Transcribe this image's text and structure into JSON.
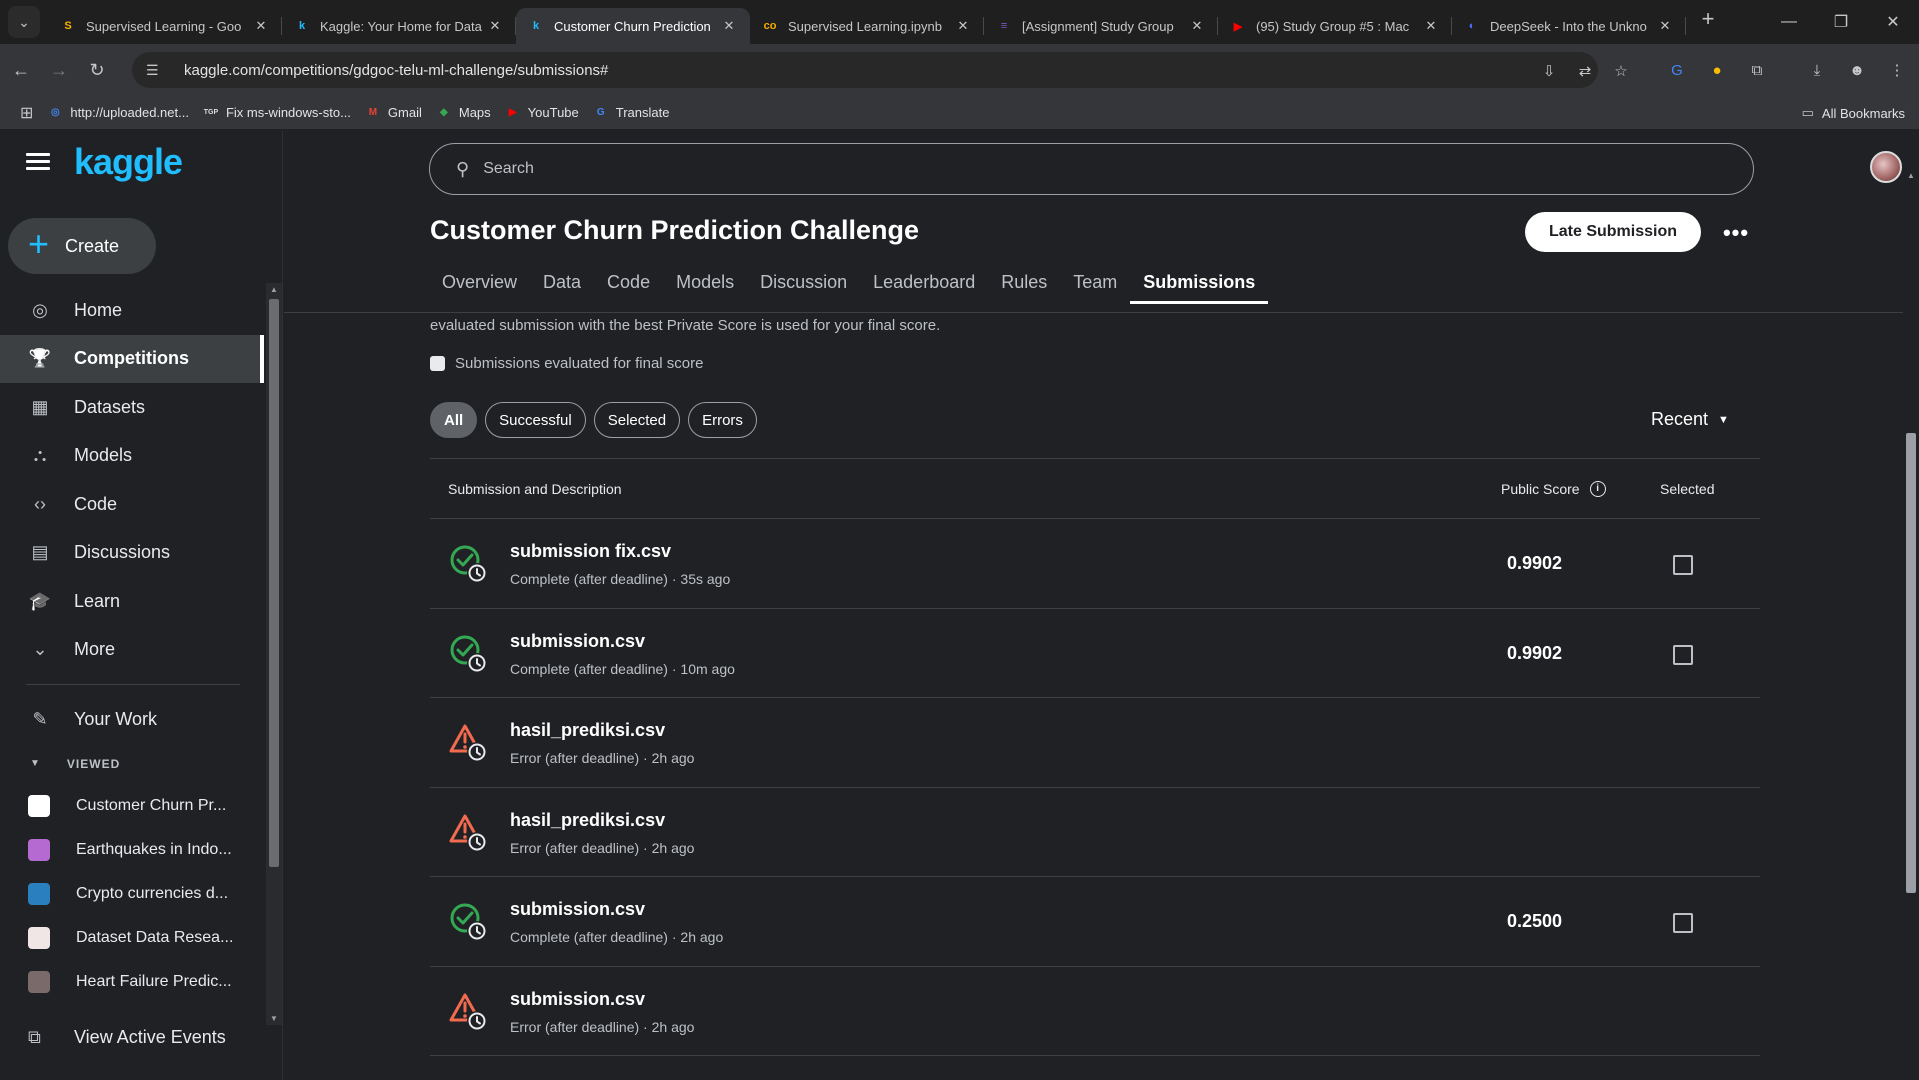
{
  "browser": {
    "tabs": [
      {
        "title": "Supervised Learning - Goo",
        "fav": "S",
        "favcolor": "#f6b400",
        "active": false
      },
      {
        "title": "Kaggle: Your Home for Data",
        "fav": "k",
        "favcolor": "#20beff",
        "active": false
      },
      {
        "title": "Customer Churn Prediction",
        "fav": "k",
        "favcolor": "#20beff",
        "active": true
      },
      {
        "title": "Supervised Learning.ipynb",
        "fav": "co",
        "favcolor": "#f9ab00",
        "active": false
      },
      {
        "title": "[Assignment] Study Group",
        "fav": "≡",
        "favcolor": "#7e57c2",
        "active": false
      },
      {
        "title": "(95) Study Group #5 : Mac",
        "fav": "▶",
        "favcolor": "#ff0000",
        "active": false
      },
      {
        "title": "DeepSeek - Into the Unkno",
        "fav": "◐",
        "favcolor": "#4d6bfe",
        "active": false
      }
    ],
    "url": "kaggle.com/competitions/gdgoc-telu-ml-challenge/submissions#",
    "bookmarks": [
      {
        "label": "http://uploaded.net...",
        "icon": "◎",
        "color": "#4285f4"
      },
      {
        "label": "Fix ms-windows-sto...",
        "icon": "TGP",
        "color": "#333333"
      },
      {
        "label": "Gmail",
        "icon": "M",
        "color": "#ea4335"
      },
      {
        "label": "Maps",
        "icon": "◆",
        "color": "#34a853"
      },
      {
        "label": "YouTube",
        "icon": "▶",
        "color": "#ff0000"
      },
      {
        "label": "Translate",
        "icon": "G",
        "color": "#4285f4"
      }
    ],
    "all_bookmarks": "All Bookmarks"
  },
  "sidebar": {
    "logo": "kaggle",
    "create": "Create",
    "nav": [
      {
        "label": "Home",
        "icon": "compass-icon",
        "glyph": "◎",
        "active": false
      },
      {
        "label": "Competitions",
        "icon": "trophy-icon",
        "glyph": "🏆",
        "active": true
      },
      {
        "label": "Datasets",
        "icon": "table-icon",
        "glyph": "▦",
        "active": false
      },
      {
        "label": "Models",
        "icon": "model-icon",
        "glyph": "⛬",
        "active": false
      },
      {
        "label": "Code",
        "icon": "code-icon",
        "glyph": "‹›",
        "active": false
      },
      {
        "label": "Discussions",
        "icon": "comment-icon",
        "glyph": "▤",
        "active": false
      },
      {
        "label": "Learn",
        "icon": "school-icon",
        "glyph": "🎓",
        "active": false
      },
      {
        "label": "More",
        "icon": "chevron-down-icon",
        "glyph": "⌄",
        "active": false
      }
    ],
    "your_work": "Your Work",
    "viewed_heading": "VIEWED",
    "viewed": [
      {
        "label": "Customer Churn Pr...",
        "color": "#ffffff"
      },
      {
        "label": "Earthquakes in Indo...",
        "color": "#b56ad1"
      },
      {
        "label": "Crypto currencies d...",
        "color": "#2a7fbf"
      },
      {
        "label": "Dataset Data Resea...",
        "color": "#f0e6e6"
      },
      {
        "label": "Heart Failure Predic...",
        "color": "#7a6a6a"
      }
    ],
    "view_active_events": "View Active Events"
  },
  "header": {
    "search_placeholder": "Search"
  },
  "competition": {
    "title": "Customer Churn Prediction Challenge",
    "late_submission": "Late Submission",
    "more": "•••",
    "tabs": [
      "Overview",
      "Data",
      "Code",
      "Models",
      "Discussion",
      "Leaderboard",
      "Rules",
      "Team",
      "Submissions"
    ],
    "active_tab": 8
  },
  "submissions": {
    "note": "evaluated submission with the best Private Score is used for your final score.",
    "final_score_checkbox": "Submissions evaluated for final score",
    "filters": [
      "All",
      "Successful",
      "Selected",
      "Errors"
    ],
    "active_filter": 0,
    "sort": "Recent",
    "columns": {
      "description": "Submission and Description",
      "public_score": "Public Score",
      "selected": "Selected"
    },
    "rows": [
      {
        "file": "submission fix.csv",
        "status": "complete",
        "meta": "Complete (after deadline) · 35s ago",
        "score": "0.9902",
        "selectable": true
      },
      {
        "file": "submission.csv",
        "status": "complete",
        "meta": "Complete (after deadline) · 10m ago",
        "score": "0.9902",
        "selectable": true
      },
      {
        "file": "hasil_prediksi.csv",
        "status": "error",
        "meta": "Error (after deadline) · 2h ago",
        "score": "",
        "selectable": false
      },
      {
        "file": "hasil_prediksi.csv",
        "status": "error",
        "meta": "Error (after deadline) · 2h ago",
        "score": "",
        "selectable": false
      },
      {
        "file": "submission.csv",
        "status": "complete",
        "meta": "Complete (after deadline) · 2h ago",
        "score": "0.2500",
        "selectable": true
      },
      {
        "file": "submission.csv",
        "status": "error",
        "meta": "Error (after deadline) · 2h ago",
        "score": "",
        "selectable": false
      }
    ]
  },
  "colors": {
    "complete": "#34a853",
    "error": "#f26b4f",
    "accent": "#20beff"
  }
}
